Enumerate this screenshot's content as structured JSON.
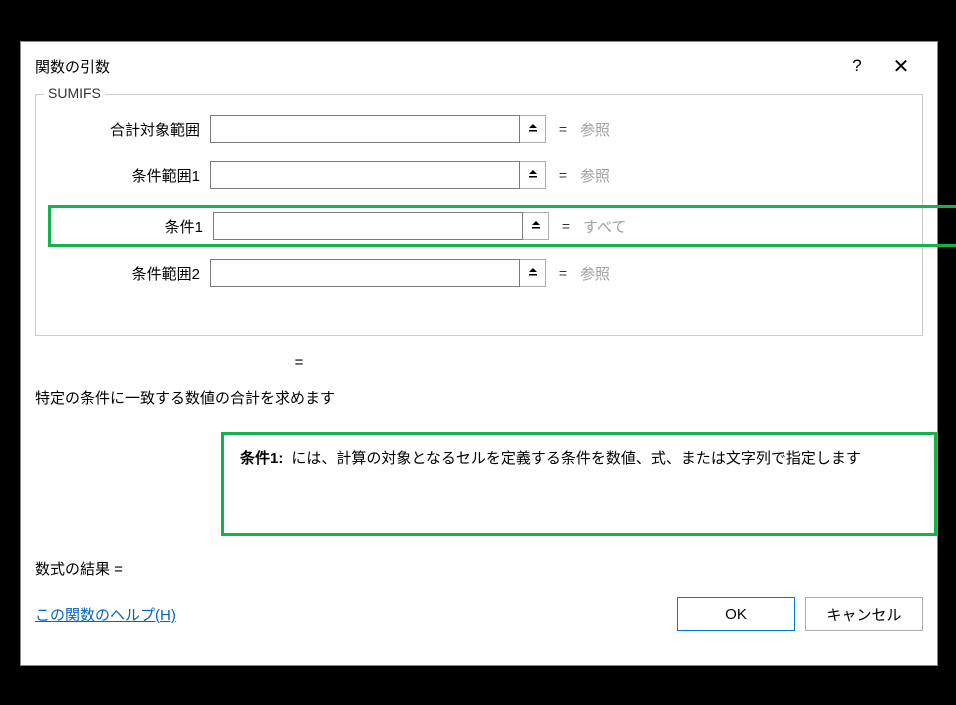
{
  "titlebar": {
    "title": "関数の引数",
    "help": "?",
    "close": "✕"
  },
  "group": {
    "name": "SUMIFS"
  },
  "args": [
    {
      "label": "合計対象範囲",
      "value": "",
      "hint": "参照"
    },
    {
      "label": "条件範囲1",
      "value": "",
      "hint": "参照"
    },
    {
      "label": "条件1",
      "value": "",
      "hint": "すべて"
    },
    {
      "label": "条件範囲2",
      "value": "",
      "hint": "参照"
    }
  ],
  "result_eq": "=",
  "description": "特定の条件に一致する数値の合計を求めます",
  "arg_desc": {
    "label": "条件1:",
    "text": "には、計算の対象となるセルを定義する条件を数値、式、または文字列で指定します"
  },
  "formula_result_label": "数式の結果 =",
  "help_link": "この関数のヘルプ(H)",
  "buttons": {
    "ok": "OK",
    "cancel": "キャンセル"
  },
  "eq_sign": "="
}
